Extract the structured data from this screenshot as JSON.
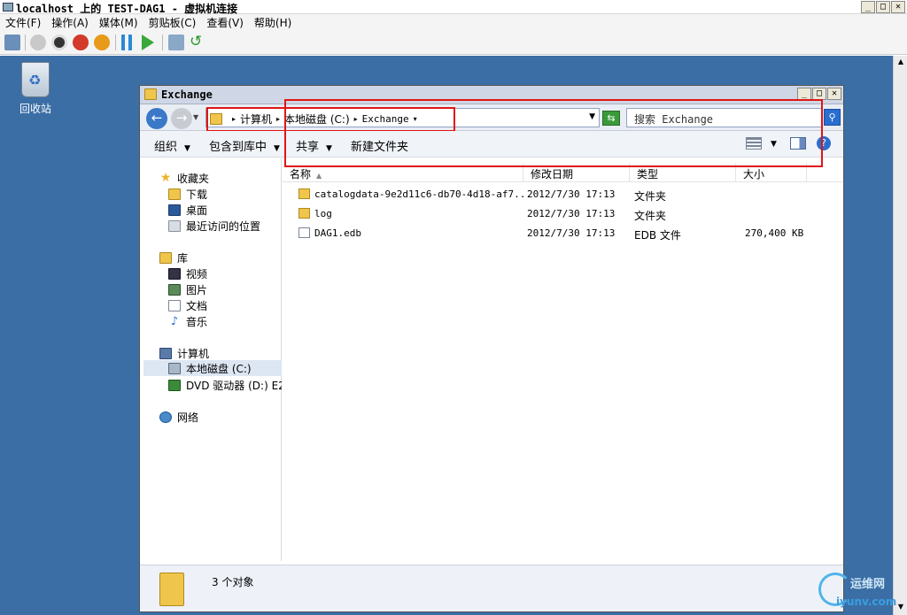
{
  "vm": {
    "title": "localhost 上的 TEST-DAG1 - 虚拟机连接",
    "menu": [
      "文件(F)",
      "操作(A)",
      "媒体(M)",
      "剪贴板(C)",
      "查看(V)",
      "帮助(H)"
    ],
    "window_buttons": [
      "_",
      "□",
      "✕"
    ]
  },
  "desktop": {
    "recycle_bin_label": "回收站",
    "background_color": "#3a6ea5"
  },
  "explorer": {
    "title": "Exchange",
    "breadcrumbs": [
      "计算机",
      "本地磁盘 (C:)",
      "Exchange"
    ],
    "search_placeholder": "搜索 Exchange",
    "commands": {
      "organize": "组织",
      "include_in_library": "包含到库中",
      "share": "共享",
      "new_folder": "新建文件夹"
    },
    "nav": {
      "favorites": "收藏夹",
      "downloads": "下载",
      "desktop": "桌面",
      "recent_places": "最近访问的位置",
      "libraries": "库",
      "videos": "视频",
      "pictures": "图片",
      "documents": "文档",
      "music": "音乐",
      "computer": "计算机",
      "local_disk": "本地磁盘 (C:)",
      "dvd_drive": "DVD 驱动器 (D:) E2",
      "network": "网络"
    },
    "columns": {
      "name": "名称",
      "date_modified": "修改日期",
      "type": "类型",
      "size": "大小"
    },
    "files": [
      {
        "name": "catalogdata-9e2d11c6-db70-4d18-af7...",
        "date": "2012/7/30 17:13",
        "type": "文件夹",
        "size": ""
      },
      {
        "name": "log",
        "date": "2012/7/30 17:13",
        "type": "文件夹",
        "size": ""
      },
      {
        "name": "DAG1.edb",
        "date": "2012/7/30 17:13",
        "type": "EDB 文件",
        "size": "270,400 KB"
      }
    ],
    "status_count": "3 个对象"
  },
  "watermark": {
    "line1": "运维网",
    "line2": "iyunv.com"
  },
  "colors": {
    "highlight_red": "#e01515",
    "folder_yellow": "#f0c54c"
  }
}
